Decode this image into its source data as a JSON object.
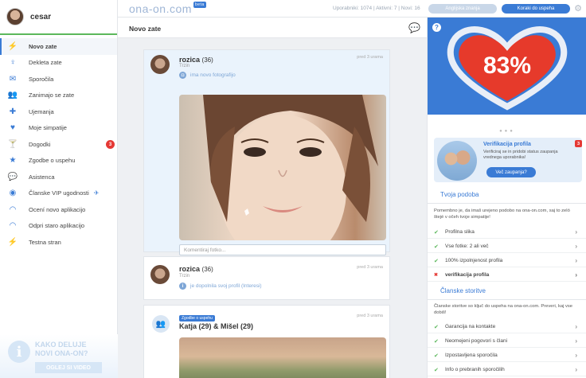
{
  "user": {
    "name": "cesar"
  },
  "nav": [
    {
      "label": "Novo zate",
      "icon": "bolt-icon"
    },
    {
      "label": "Dekleta zate",
      "icon": "woman-icon"
    },
    {
      "label": "Sporočila",
      "icon": "messages-icon"
    },
    {
      "label": "Zanimajo se zate",
      "icon": "people-icon"
    },
    {
      "label": "Ujemanja",
      "icon": "match-icon"
    },
    {
      "label": "Moje simpatije",
      "icon": "heart-icon"
    },
    {
      "label": "Dogodki",
      "icon": "cocktail-icon",
      "badge": "3"
    },
    {
      "label": "Zgodbe o uspehu",
      "icon": "star-icon"
    },
    {
      "label": "Asistenca",
      "icon": "chat-icon"
    },
    {
      "label": "Članske VIP ugodnosti",
      "icon": "vip-icon"
    },
    {
      "label": "Ocení novo aplikacijo",
      "icon": "wifi-icon"
    },
    {
      "label": "Odpri staro aplikacijo",
      "icon": "wifi-icon"
    },
    {
      "label": "Testna stran",
      "icon": "bolt-icon"
    }
  ],
  "promo": {
    "line1": "KAKO DELUJE",
    "line2": "NOVI ONA-ON?",
    "button": "OGLEJ SI VIDEO"
  },
  "topbar": {
    "logo": "ona-on.com",
    "beta": "beta",
    "stats": "Uporabniki: 1074 | Aktivni: 7 | Novi: 16",
    "btn1": "Anglijska znanja",
    "btn2": "Koraki do uspeha"
  },
  "feed": {
    "title": "Novo zate",
    "posts": [
      {
        "name": "rozica",
        "age": "(36)",
        "city": "Trzin",
        "time": "pred 3 urama",
        "action": "ima novo fotografijo",
        "comment_placeholder": "Komentiraj fotko..."
      },
      {
        "name": "rozica",
        "age": "(36)",
        "city": "Trzin",
        "time": "pred 3 urama",
        "action": "je dopolnila svoj profil (Interesi)"
      },
      {
        "tag": "Zgodbe o uspehu",
        "name": "Katja (29) & Mišel (29)",
        "time": "pred 3 urama"
      }
    ]
  },
  "right": {
    "percent": "83%",
    "verify": {
      "title": "Verifikacija profila",
      "text": "Verificiraj se in pridobi status zaupanja vrednega uporabnika!",
      "button": "Več zaupanja?",
      "badge": "3"
    },
    "similarity": {
      "title": "Tvoja podoba",
      "text": "Pomembno je, da imaš urejeno podobo na ona-on.com, saj to zeló štejé v očeh tvoje simpatije!",
      "items": [
        {
          "label": "Profilna slika",
          "done": true
        },
        {
          "label": "Vse fotke: 2 ali več",
          "done": true
        },
        {
          "label": "100% izpolnjenost profila",
          "done": true
        },
        {
          "label": "verifikacija profila",
          "done": false
        }
      ]
    },
    "member": {
      "title": "Članske storitve",
      "text": "Članske storitve so ključ do uspeha na ona-on.com. Preveri, kaj vse dobiš!",
      "items": [
        {
          "label": "Garancija na kontakte"
        },
        {
          "label": "Neomejeni pogovori s člani"
        },
        {
          "label": "Izpostavljena sporočila"
        },
        {
          "label": "Info o prebranih sporočilih"
        }
      ]
    }
  }
}
